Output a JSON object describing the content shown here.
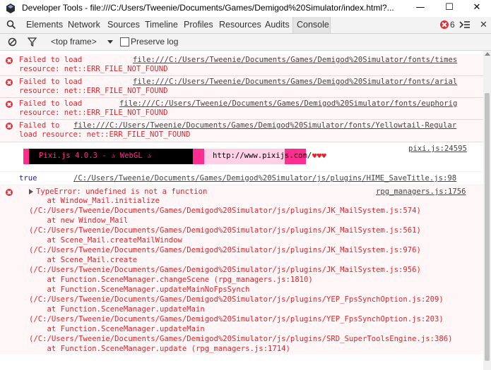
{
  "window": {
    "title": "Developer Tools - file:///C:/Users/Tweenie/Documents/Games/Demigod%20Simulator/index.html?...",
    "minimize": "—",
    "maximize": "☐",
    "close": "✕"
  },
  "tabs": [
    "Elements",
    "Network",
    "Sources",
    "Timeline",
    "Profiles",
    "Resources",
    "Audits",
    "Console"
  ],
  "active_tab": "Console",
  "error_count": "6",
  "filter": {
    "context": "<top frame>",
    "preserve_log": "Preserve log"
  },
  "messages": [
    {
      "line1_text": "Failed to load ",
      "url": "file:///C:/Users/Tweenie/Documents/Games/Demigod%20Simulator/fonts/times",
      "line2_text": "resource: net::ERR_FILE_NOT_FOUND"
    },
    {
      "line1_text": "Failed to load ",
      "url": "file:///C:/Users/Tweenie/Documents/Games/Demigod%20Simulator/fonts/arial",
      "line2_text": "resource: net::ERR_FILE_NOT_FOUND"
    },
    {
      "line1_text": "Failed to load ",
      "url": "file:///C:/Users/Tweenie/Documents/Games/Demigod%20Simulator/fonts/euphorig",
      "line2_text": "resource: net::ERR_FILE_NOT_FOUND"
    },
    {
      "line1_text": "Failed to ",
      "url": "file:///C:/Users/Tweenie/Documents/Games/Demigod%20Simulator/fonts/Yellowtail-Regular",
      "line2_text": "load resource: net::ERR_FILE_NOT_FOUND"
    }
  ],
  "pixi": {
    "source": "pixi.js:24595",
    "banner": "Pixi.js 4.0.3 - ✰ WebGL ✰",
    "url": "http://www.pixijs.com/",
    "hearts": "♥♥♥"
  },
  "log_true": {
    "value": "true",
    "source": "/C:/Users/Tweenie/Documents/Games/Demigod%20Simulator/js/plugins/HIME_SaveTitle.js:98"
  },
  "type_error": {
    "message": "TypeError: undefined is not a function",
    "source": "rpg_managers.js:1756",
    "stack": [
      {
        "at": "    at Window_Mail.initialize",
        "loc": "(/C:/Users/Tweenie/Documents/Games/Demigod%20Simulator/js/plugins/JK_MailSystem.js:574)"
      },
      {
        "at": "    at new Window_Mail",
        "loc": "(/C:/Users/Tweenie/Documents/Games/Demigod%20Simulator/js/plugins/JK_MailSystem.js:561)"
      },
      {
        "at": "    at Scene_Mail.createMailWindow",
        "loc": "(/C:/Users/Tweenie/Documents/Games/Demigod%20Simulator/js/plugins/JK_MailSystem.js:976)"
      },
      {
        "at": "    at Scene_Mail.create",
        "loc": "(/C:/Users/Tweenie/Documents/Games/Demigod%20Simulator/js/plugins/JK_MailSystem.js:956)"
      },
      {
        "at": "    at Function.SceneManager.changeScene (rpg_managers.js:1810)",
        "loc": ""
      },
      {
        "at": "    at Function.SceneManager.updateMainNoFpsSynch",
        "loc": "(/C:/Users/Tweenie/Documents/Games/Demigod%20Simulator/js/plugins/YEP_FpsSynchOption.js:209)"
      },
      {
        "at": "    at Function.SceneManager.updateMain",
        "loc": "(/C:/Users/Tweenie/Documents/Games/Demigod%20Simulator/js/plugins/YEP_FpsSynchOption.js:203)"
      },
      {
        "at": "    at Function.SceneManager.updateMain",
        "loc": "(/C:/Users/Tweenie/Documents/Games/Demigod%20Simulator/js/plugins/SRD_SuperToolsEngine.js:386)"
      },
      {
        "at": "    at Function.SceneManager.update (rpg_managers.js:1714)",
        "loc": ""
      }
    ]
  },
  "colors": {
    "error_red": "#e1252c",
    "pixi_pink": "#ff2d8f",
    "true_blue": "#1a1aa6"
  }
}
